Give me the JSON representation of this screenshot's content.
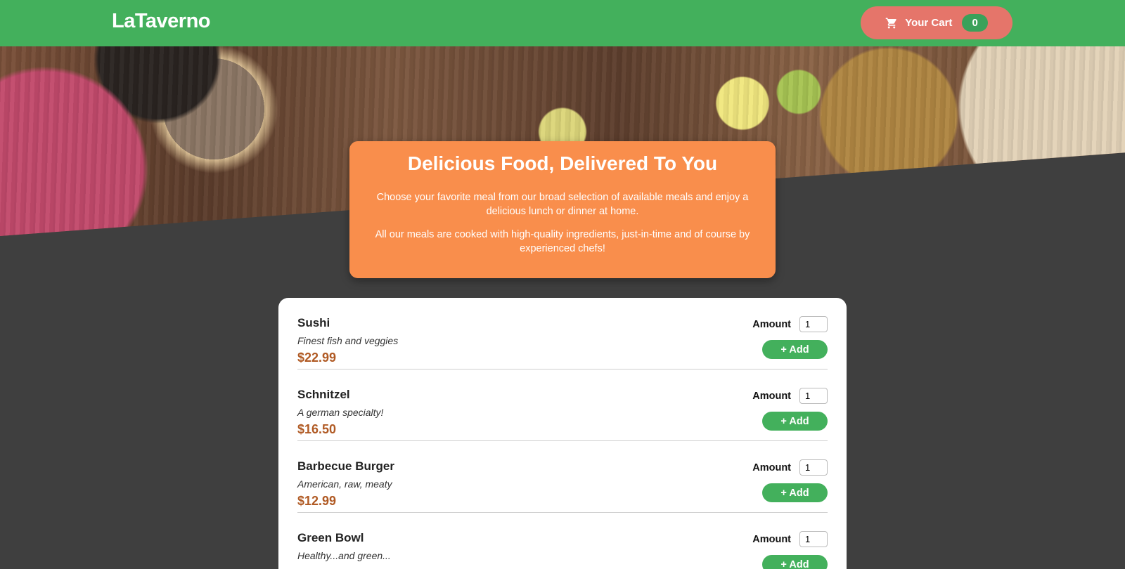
{
  "header": {
    "logo": "LaTaverno",
    "cart_label": "Your Cart",
    "cart_count": "0",
    "brand_color": "#43b05c",
    "cart_color": "#e5756a"
  },
  "intro": {
    "title": "Delicious Food, Delivered To You",
    "paragraph1": "Choose your favorite meal from our broad selection of available meals and enjoy a delicious lunch or dinner at home.",
    "paragraph2": "All our meals are cooked with high-quality ingredients, just-in-time and of course by experienced chefs!"
  },
  "meals": [
    {
      "name": "Sushi",
      "description": "Finest fish and veggies",
      "price": "$22.99",
      "amount_label": "Amount",
      "amount_value": "1",
      "add_label": "+ Add"
    },
    {
      "name": "Schnitzel",
      "description": "A german specialty!",
      "price": "$16.50",
      "amount_label": "Amount",
      "amount_value": "1",
      "add_label": "+ Add"
    },
    {
      "name": "Barbecue Burger",
      "description": "American, raw, meaty",
      "price": "$12.99",
      "amount_label": "Amount",
      "amount_value": "1",
      "add_label": "+ Add"
    },
    {
      "name": "Green Bowl",
      "description": "Healthy...and green...",
      "price": "",
      "amount_label": "Amount",
      "amount_value": "1",
      "add_label": "+ Add"
    }
  ]
}
